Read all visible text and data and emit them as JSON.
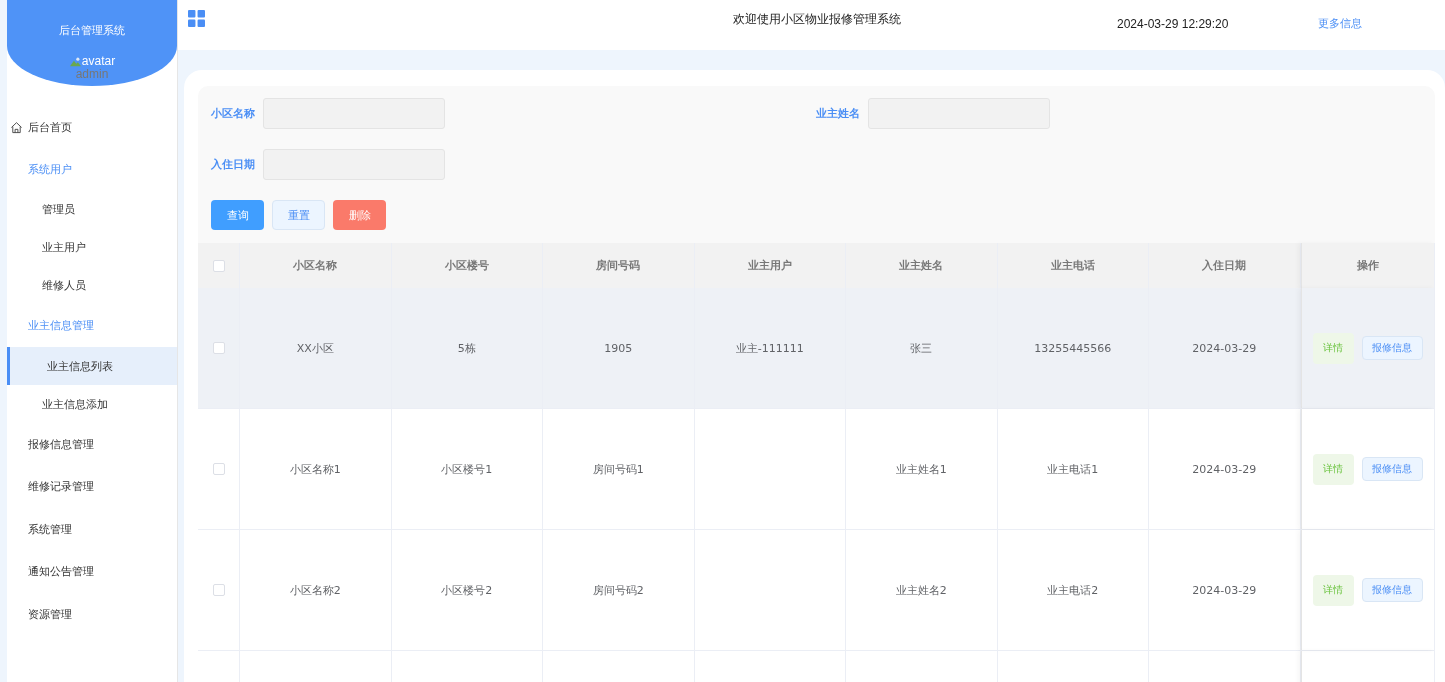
{
  "sidebar": {
    "title": "后台管理系统",
    "avatar_alt": "avatar",
    "user": "admin",
    "menu": [
      {
        "label": "后台首页",
        "kind": "home"
      },
      {
        "label": "系统用户",
        "kind": "group",
        "expanded": true,
        "children": [
          {
            "label": "管理员",
            "selected": false
          },
          {
            "label": "业主用户",
            "selected": false
          },
          {
            "label": "维修人员",
            "selected": false
          }
        ]
      },
      {
        "label": "业主信息管理",
        "kind": "group",
        "expanded": true,
        "children": [
          {
            "label": "业主信息列表",
            "selected": true
          },
          {
            "label": "业主信息添加",
            "selected": false
          }
        ]
      },
      {
        "label": "报修信息管理",
        "kind": "group",
        "expanded": false
      },
      {
        "label": "维修记录管理",
        "kind": "group",
        "expanded": false
      },
      {
        "label": "系统管理",
        "kind": "group",
        "expanded": false
      },
      {
        "label": "通知公告管理",
        "kind": "group",
        "expanded": false
      },
      {
        "label": "资源管理",
        "kind": "group",
        "expanded": false
      }
    ]
  },
  "topbar": {
    "title": "欢迎使用小区物业报修管理系统",
    "datetime": "2024-03-29 12:29:20",
    "more_link": "更多信息"
  },
  "search": {
    "fields": [
      {
        "label": "小区名称"
      },
      {
        "label": "业主姓名"
      },
      {
        "label": "入住日期"
      }
    ],
    "buttons": [
      {
        "label": "查询",
        "kind": "primary"
      },
      {
        "label": "重置",
        "kind": "plain"
      },
      {
        "label": "删除",
        "kind": "danger"
      }
    ]
  },
  "table": {
    "select_all": {
      "checked": false
    },
    "columns": [
      "小区名称",
      "小区楼号",
      "房间号码",
      "业主用户",
      "业主姓名",
      "业主电话",
      "入住日期",
      "操作"
    ],
    "rows": [
      {
        "checked": false,
        "highlighted": true,
        "cells": [
          "XX小区",
          "5栋",
          "1905",
          "业主-111111",
          "张三",
          "13255445566",
          "2024-03-29"
        ],
        "actions": [
          "详情",
          "报修信息"
        ]
      },
      {
        "checked": false,
        "highlighted": false,
        "cells": [
          "小区名称1",
          "小区楼号1",
          "房间号码1",
          "",
          "业主姓名1",
          "业主电话1",
          "2024-03-29"
        ],
        "actions": [
          "详情",
          "报修信息"
        ]
      },
      {
        "checked": false,
        "highlighted": false,
        "cells": [
          "小区名称2",
          "小区楼号2",
          "房间号码2",
          "",
          "业主姓名2",
          "业主电话2",
          "2024-03-29"
        ],
        "actions": [
          "详情",
          "报修信息"
        ]
      }
    ]
  }
}
